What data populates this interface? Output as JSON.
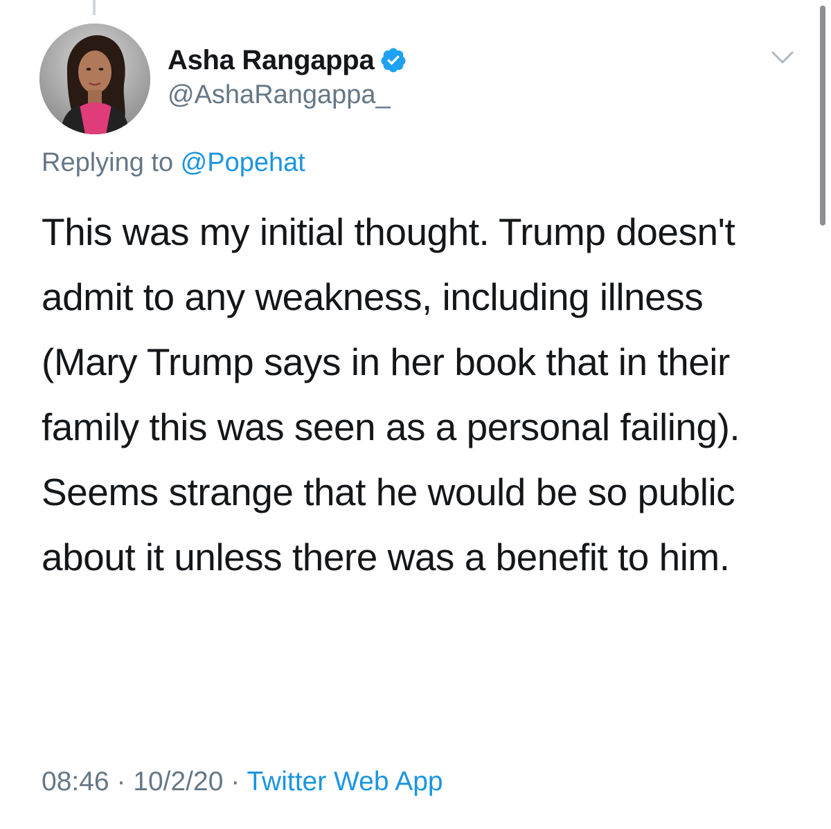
{
  "tweet": {
    "author": {
      "display_name": "Asha Rangappa",
      "handle": "@AshaRangappa_",
      "verified": true
    },
    "replying_prefix": "Replying to ",
    "replying_to": "@Popehat",
    "text": "This was my initial thought. Trump doesn't admit to any weakness, including illness (Mary Trump says in her book that in their family this was seen as a personal failing). Seems strange that he would be so public about it unless there was a benefit to him.",
    "time": "08:46",
    "date": "10/2/20",
    "separator": " · ",
    "source": "Twitter Web App"
  },
  "icons": {
    "verified": "verified-badge-icon",
    "caret": "chevron-down-icon"
  },
  "colors": {
    "text": "#14171a",
    "secondary": "#657786",
    "link": "#1b95e0",
    "verified": "#1da1f2"
  }
}
